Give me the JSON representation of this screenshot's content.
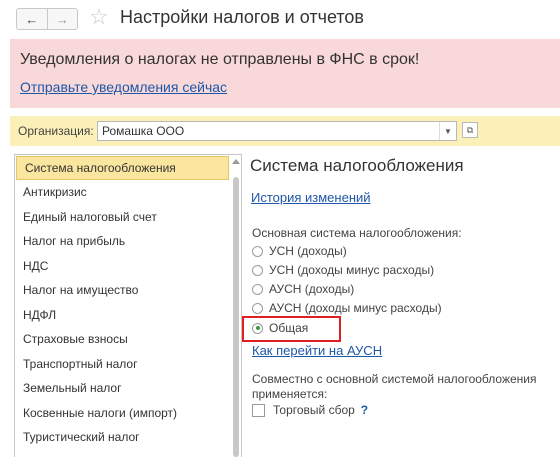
{
  "window": {
    "title": "Настройки налогов и отчетов",
    "back_icon": "←",
    "forward_icon": "→",
    "favorite_icon": "☆"
  },
  "warning": {
    "message": "Уведомления о налогах не отправлены в ФНС в срок!",
    "link": "Отправьте уведомления сейчас"
  },
  "organization": {
    "label": "Организация:",
    "value": "Ромашка ООО",
    "dropdown_icon": "▼",
    "open_icon": "⧉"
  },
  "sidebar": {
    "items": [
      {
        "label": "Система налогообложения"
      },
      {
        "label": "Антикризис"
      },
      {
        "label": "Единый налоговый счет"
      },
      {
        "label": "Налог на прибыль"
      },
      {
        "label": "НДС"
      },
      {
        "label": "Налог на имущество"
      },
      {
        "label": "НДФЛ"
      },
      {
        "label": "Страховые взносы"
      },
      {
        "label": "Транспортный налог"
      },
      {
        "label": "Земельный налог"
      },
      {
        "label": "Косвенные налоги (импорт)"
      },
      {
        "label": "Туристический налог"
      }
    ]
  },
  "main": {
    "title": "Система налогообложения",
    "history_link": "История изменений",
    "tax_system_label": "Основная система налогообложения:",
    "options": [
      {
        "label": "УСН (доходы)",
        "selected": false
      },
      {
        "label": "УСН (доходы минус расходы)",
        "selected": false
      },
      {
        "label": "АУСН (доходы)",
        "selected": false
      },
      {
        "label": "АУСН (доходы минус расходы)",
        "selected": false
      },
      {
        "label": "Общая",
        "selected": true
      }
    ],
    "ausn_link": "Как перейти на АУСН",
    "joint_label": "Совместно с основной системой налогообложения применяется:",
    "trade_fee_label": "Торговый сбор",
    "help": "?"
  },
  "colors": {
    "warning_bg": "#f8d8d8",
    "org_bar_bg": "#fbf0b8",
    "active_item_bg": "#fbe6a0",
    "link": "#1f57a8",
    "highlight_border": "#e02020",
    "radio_selected": "#3a9a3a"
  }
}
